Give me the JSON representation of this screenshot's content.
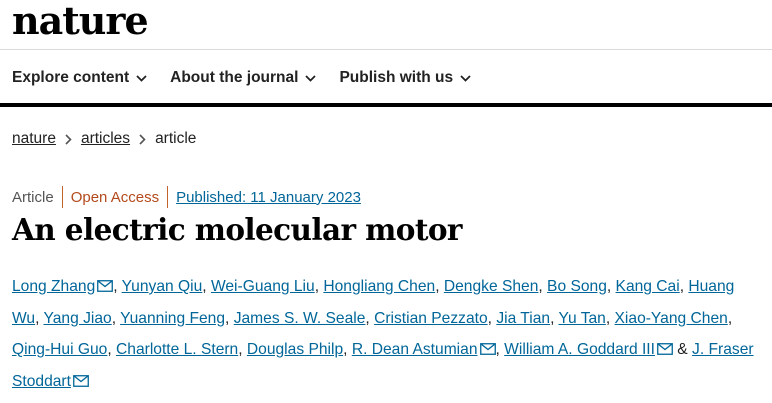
{
  "site": {
    "logo_text": "nature"
  },
  "nav": {
    "items": [
      {
        "label": "Explore content"
      },
      {
        "label": "About the journal"
      },
      {
        "label": "Publish with us"
      }
    ]
  },
  "breadcrumb": {
    "items": [
      "nature",
      "articles",
      "article"
    ]
  },
  "article": {
    "type": "Article",
    "access": "Open Access",
    "published": "Published: 11 January 2023",
    "title": "An electric molecular motor"
  },
  "authors": [
    "Long Zhang",
    "Yunyan Qiu",
    "Wei-Guang Liu",
    "Hongliang Chen",
    "Dengke Shen",
    "Bo Song",
    "Kang Cai",
    "Huang Wu",
    "Yang Jiao",
    "Yuanning Feng",
    "James S. W. Seale",
    "Cristian Pezzato",
    "Jia Tian",
    "Yu Tan",
    "Xiao-Yang Chen",
    "Qing-Hui Guo",
    "Charlotte L. Stern",
    "Douglas Philp",
    "R. Dean Astumian",
    "William A. Goddard III",
    "J. Fraser Stoddart"
  ],
  "author_separators": [
    ", ",
    ", ",
    ", ",
    ", ",
    ", ",
    ", ",
    ", ",
    ", ",
    ", ",
    ", ",
    ", ",
    ", ",
    ", ",
    ", ",
    ", ",
    ", ",
    ", ",
    ", ",
    ", ",
    " & "
  ],
  "author_email_icons": [
    "mail-icon",
    "",
    "",
    "",
    "",
    "",
    "",
    "",
    "",
    "",
    "",
    "",
    "",
    "",
    "",
    "",
    "",
    "",
    "mail-icon",
    "mail-icon",
    "mail-icon"
  ],
  "colors": {
    "link": "#006699",
    "open_access": "#b44a1c",
    "separator": "#c4632b",
    "text": "#222222"
  }
}
